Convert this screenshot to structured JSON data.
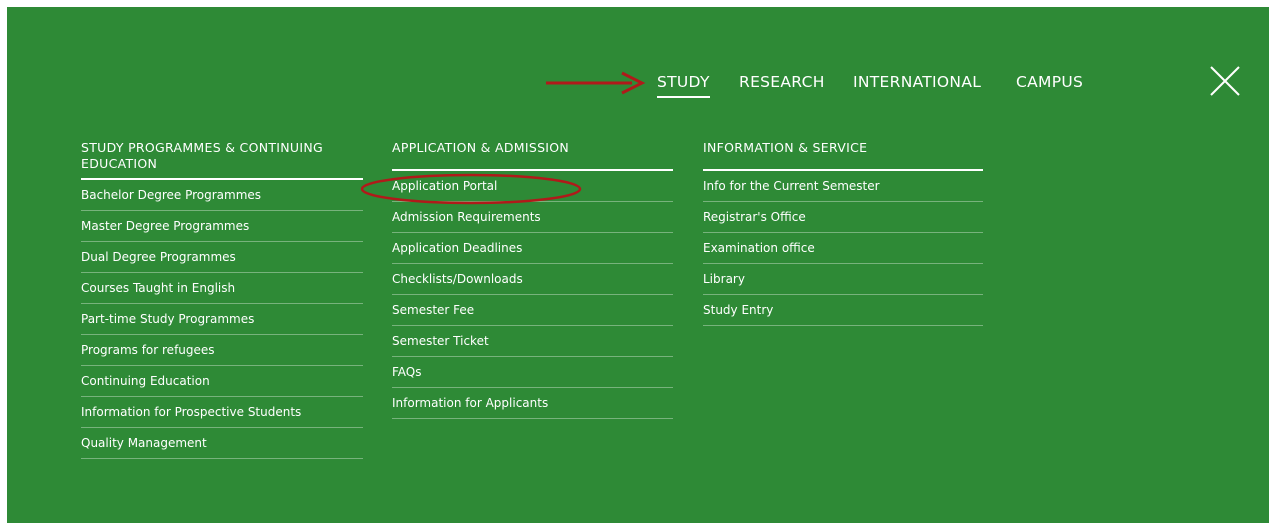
{
  "nav": {
    "items": [
      {
        "label": "STUDY",
        "active": true
      },
      {
        "label": "RESEARCH",
        "active": false
      },
      {
        "label": "INTERNATIONAL",
        "active": false
      },
      {
        "label": "CAMPUS",
        "active": false
      }
    ],
    "close_icon": "close-icon"
  },
  "columns": [
    {
      "heading": "STUDY PROGRAMMES & CONTINUING EDUCATION",
      "items": [
        "Bachelor Degree Programmes",
        "Master Degree Programmes",
        "Dual Degree Programmes",
        "Courses Taught in English",
        "Part-time Study Programmes",
        "Programs for refugees",
        "Continuing Education",
        "Information for Prospective Students",
        "Quality Management"
      ]
    },
    {
      "heading": "APPLICATION & ADMISSION",
      "items": [
        "Application Portal",
        "Admission Requirements",
        "Application Deadlines",
        "Checklists/Downloads",
        "Semester Fee",
        "Semester Ticket",
        "FAQs",
        "Information for Applicants"
      ]
    },
    {
      "heading": "INFORMATION & SERVICE",
      "items": [
        "Info for the Current Semester",
        "Registrar's Office",
        "Examination office",
        "Library",
        "Study Entry"
      ]
    }
  ],
  "annotations": {
    "arrow_color": "#b01a1a",
    "highlight_color": "#b01a1a",
    "highlighted_item": "Application Portal"
  },
  "colors": {
    "panel_background": "#2e8a36",
    "text": "#ffffff"
  }
}
